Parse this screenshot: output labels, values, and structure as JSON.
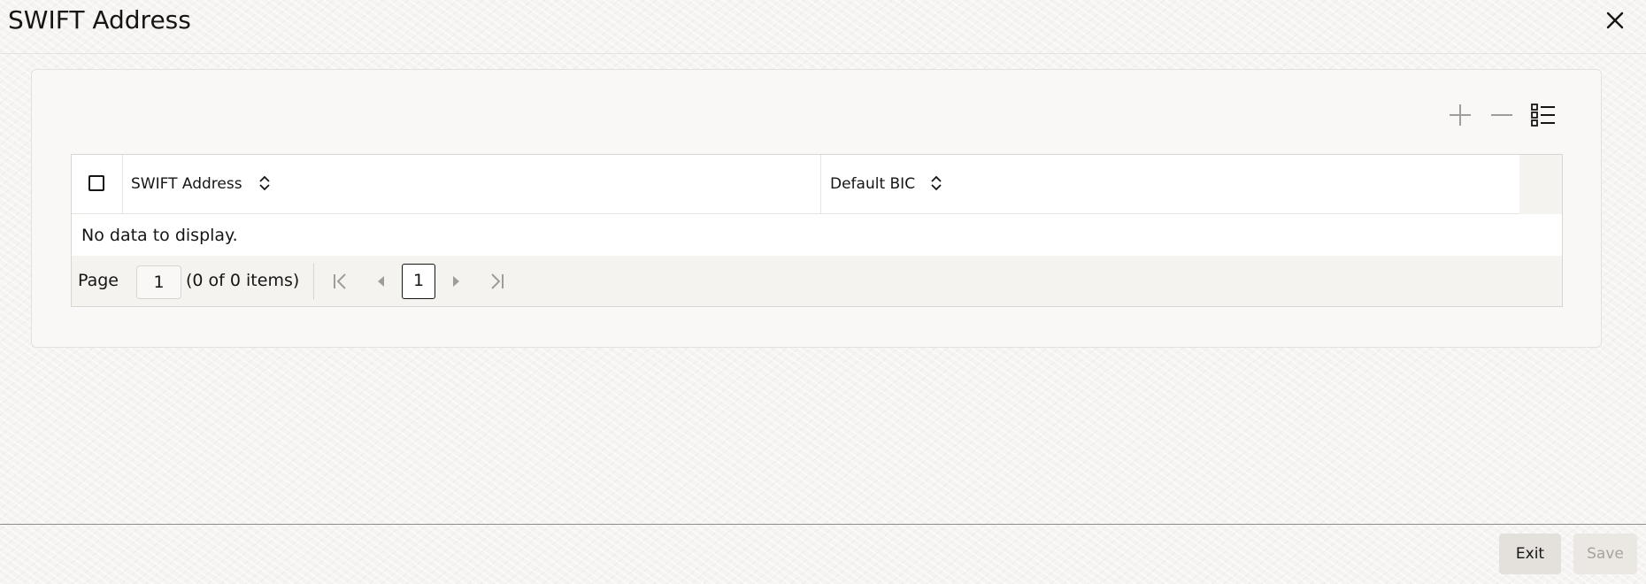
{
  "window": {
    "title": "SWIFT Address"
  },
  "icons": {
    "close": "close-icon",
    "add": "plus-icon",
    "remove": "minus-icon",
    "single_record_view": "list-view-icon",
    "sort": "sort-icon",
    "first_page": "first-page-icon",
    "previous_page": "previous-page-icon",
    "next_page": "next-page-icon",
    "last_page": "last-page-icon"
  },
  "grid": {
    "columns": [
      {
        "label": "SWIFT Address"
      },
      {
        "label": "Default BIC"
      }
    ],
    "rows": [],
    "empty_message": "No data to display."
  },
  "pagination": {
    "page_label": "Page",
    "page_input_value": "1",
    "item_count": "(0 of 0 items)",
    "current_page": "1"
  },
  "footer": {
    "exit_label": "Exit",
    "save_label": "Save",
    "save_enabled": false
  },
  "colors": {
    "text": "#161513",
    "disabled_text": "#a6a29d",
    "icon_muted": "#a09c97",
    "panel_background": "#f9f8f6"
  }
}
